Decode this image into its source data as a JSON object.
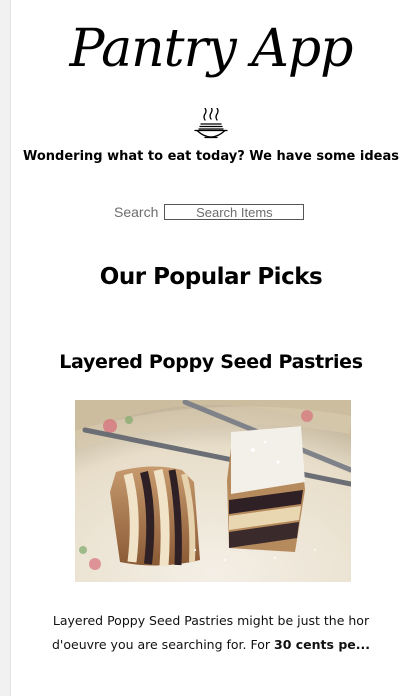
{
  "header": {
    "app_title": "Pantry App",
    "logo_icon": "noodle-bowl-icon",
    "tagline": "Wondering what to eat today? We have some ideas"
  },
  "search": {
    "label": "Search",
    "placeholder": "Search Items",
    "value": ""
  },
  "popular": {
    "heading": "Our Popular Picks",
    "items": [
      {
        "title": "Layered Poppy Seed Pastries",
        "image_alt": "Layered poppy seed pastries on a plate with chopsticks",
        "description_prefix": "Layered Poppy Seed Pastries might be just the hor d'oeuvre you are searching for. For ",
        "description_bold": "30 cents pe..."
      }
    ]
  }
}
